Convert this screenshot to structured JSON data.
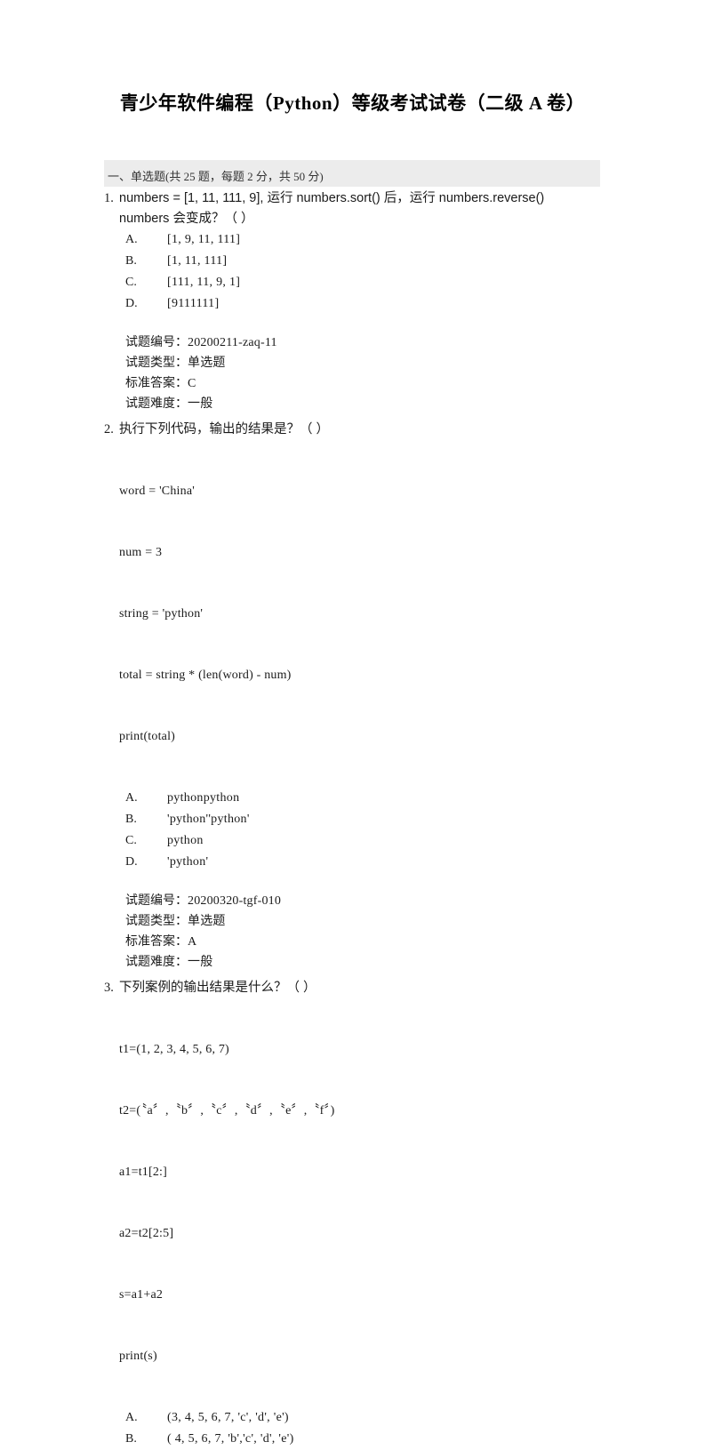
{
  "document": {
    "title": "青少年软件编程（Python）等级考试试卷（二级 A 卷）"
  },
  "section": {
    "header": "一、单选题(共 25 题，每题 2 分，共 50 分)",
    "background_color": "#ececec"
  },
  "labels": {
    "meta_id": "试题编号：",
    "meta_type": "试题类型：",
    "meta_answer": "标准答案：",
    "meta_difficulty": "试题难度："
  },
  "questions": [
    {
      "number": "1.",
      "stem_lines": [
        "numbers = [1, 11, 111, 9], 运行 numbers.sort()  后，运行 numbers.reverse()",
        "numbers 会变成？（ ）"
      ],
      "code_lines": [],
      "options": [
        {
          "letter": "A.",
          "text": "[1, 9, 11, 111]"
        },
        {
          "letter": "B.",
          "text": "[1, 11, 111]"
        },
        {
          "letter": "C.",
          "text": "[111, 11, 9, 1]"
        },
        {
          "letter": "D.",
          "text": "[9111111]"
        }
      ],
      "meta": {
        "id": "20200211-zaq-11",
        "type": "单选题",
        "answer": "C",
        "difficulty": "一般"
      }
    },
    {
      "number": "2.",
      "stem_lines": [
        "执行下列代码，输出的结果是？（ ）"
      ],
      "code_lines": [
        "word = 'China'",
        "num = 3",
        "string = 'python'",
        "total = string * (len(word) - num)",
        "print(total)"
      ],
      "options": [
        {
          "letter": "A.",
          "text": "pythonpython"
        },
        {
          "letter": "B.",
          "text": "'python''python'"
        },
        {
          "letter": "C.",
          "text": "python"
        },
        {
          "letter": "D.",
          "text": "'python'"
        }
      ],
      "meta": {
        "id": "20200320-tgf-010",
        "type": "单选题",
        "answer": "A",
        "difficulty": "一般"
      }
    },
    {
      "number": "3.",
      "stem_lines": [
        "下列案例的输出结果是什么？（ ）"
      ],
      "code_lines": [
        "t1=(1, 2, 3, 4, 5, 6, 7)",
        "t2=(〝a〞,〝b〞,〝c〞,〝d〞,〝e〞,〝f〞)",
        "a1=t1[2:]",
        "a2=t2[2:5]",
        "s=a1+a2",
        "print(s)"
      ],
      "options": [
        {
          "letter": "A.",
          "text": "(3, 4, 5, 6, 7, 'c', 'd', 'e')"
        },
        {
          "letter": "B.",
          "text": "( 4, 5, 6, 7, 'b','c', 'd', 'e')"
        }
      ],
      "meta": null
    }
  ]
}
